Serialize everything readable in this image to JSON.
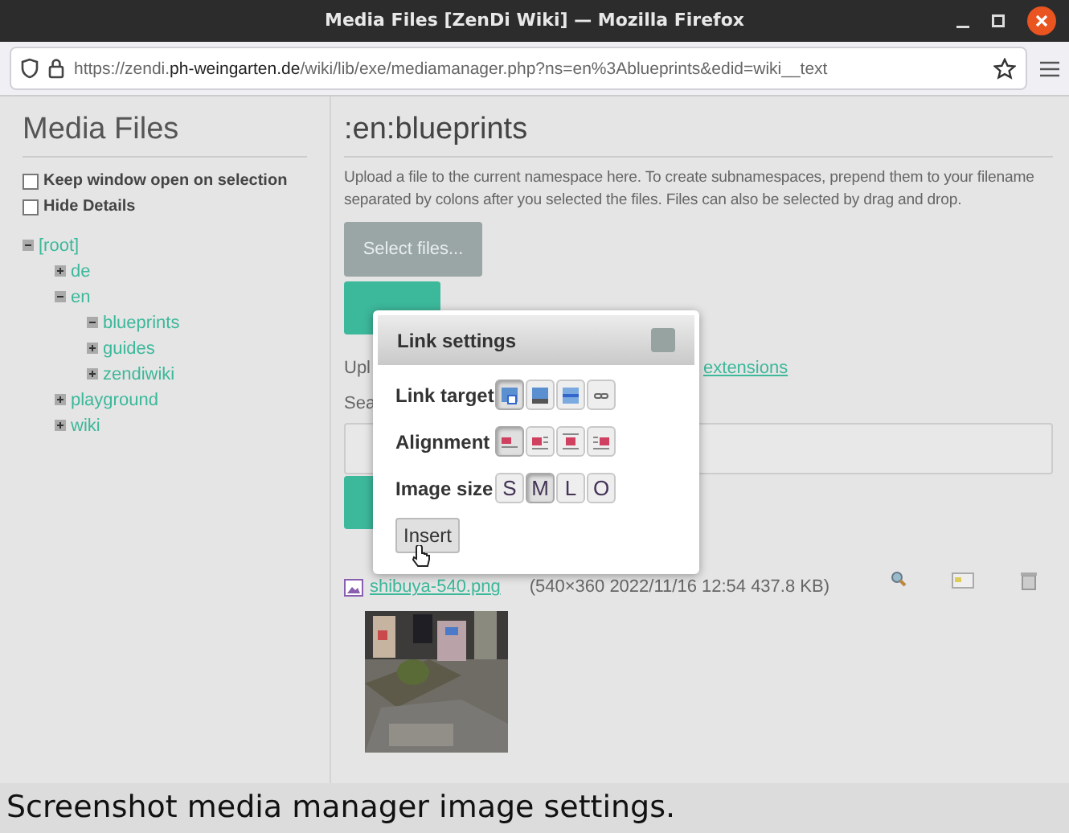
{
  "window": {
    "title": "Media Files [ZenDi Wiki] — Mozilla Firefox"
  },
  "address_bar": {
    "url": "https://zendi.**ph-weingarten.de**/wiki/lib/exe/mediamanager.php?ns=en%3Ablueprints&edid=wiki__text"
  },
  "sidebar": {
    "title": "Media Files",
    "options": [
      {
        "label": "Keep window open on selection",
        "checked": false
      },
      {
        "label": "Hide Details",
        "checked": false
      }
    ],
    "tree": [
      {
        "label": "[root]",
        "expanded": true,
        "children": [
          {
            "label": "de",
            "expanded": false
          },
          {
            "label": "en",
            "expanded": true,
            "children": [
              {
                "label": "blueprints",
                "expanded": true
              },
              {
                "label": "guides",
                "expanded": false
              },
              {
                "label": "zendiwiki",
                "expanded": false
              }
            ]
          },
          {
            "label": "playground",
            "expanded": false
          },
          {
            "label": "wiki",
            "expanded": false
          }
        ]
      }
    ]
  },
  "main": {
    "title": ":en:blueprints",
    "description": "Upload a file to the current namespace here. To create subnamespaces, prepend them to your filename separated by colons after you selected the files. Files can also be selected by drag and drop.",
    "select_button": {
      "label": "Select files...",
      "disabled": true
    },
    "upload_button": {
      "disabled": false
    },
    "info_line": {
      "start": "Upl",
      "link": "extensions"
    },
    "search_label": "Sea",
    "search_button": {
      "disabled": false
    },
    "file": {
      "name": "shibuya-540.png",
      "details": "(540×360 2022/11/16 12:54 437.8 KB)"
    }
  },
  "dialog": {
    "title": "Link settings",
    "rows": [
      {
        "label": "Link target",
        "kind": "target",
        "options": [
          {
            "selected": true
          },
          {
            "selected": false
          },
          {
            "selected": false
          },
          {
            "selected": false
          }
        ]
      },
      {
        "label": "Alignment",
        "kind": "align",
        "options": [
          {
            "selected": true
          },
          {
            "selected": false
          },
          {
            "selected": false
          },
          {
            "selected": false
          }
        ]
      },
      {
        "label": "Image size",
        "kind": "letters",
        "options": [
          {
            "label": "S",
            "selected": false
          },
          {
            "label": "M",
            "selected": true
          },
          {
            "label": "L",
            "selected": false
          },
          {
            "label": "O",
            "selected": false
          }
        ]
      }
    ],
    "insert_button": "Insert"
  },
  "caption": "Screenshot media manager image settings."
}
